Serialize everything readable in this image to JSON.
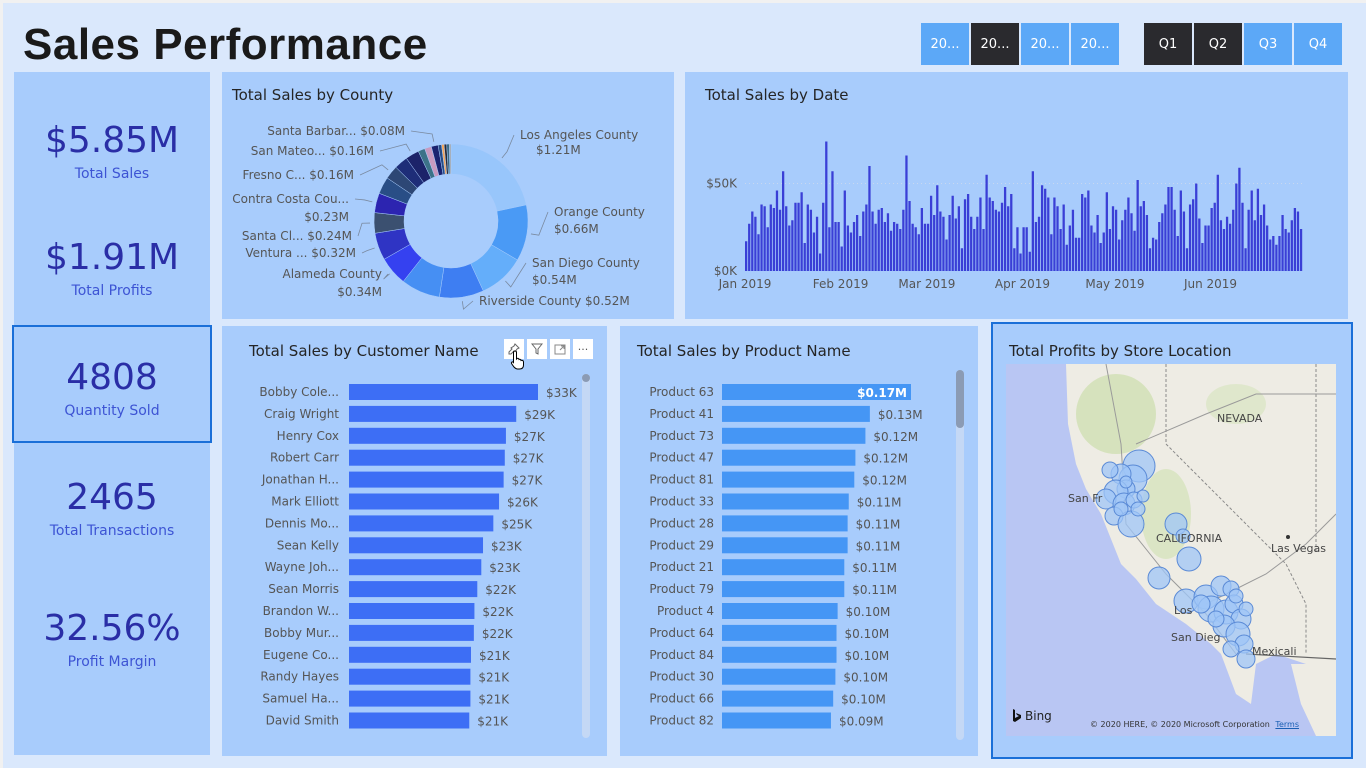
{
  "header": {
    "title": "Sales Performance"
  },
  "year_slicer": {
    "items": [
      {
        "label": "20...",
        "selected": false
      },
      {
        "label": "20...",
        "selected": true
      },
      {
        "label": "20...",
        "selected": false
      },
      {
        "label": "20...",
        "selected": false
      }
    ]
  },
  "quarter_slicer": {
    "items": [
      {
        "label": "Q1",
        "selected": true
      },
      {
        "label": "Q2",
        "selected": true
      },
      {
        "label": "Q3",
        "selected": false
      },
      {
        "label": "Q4",
        "selected": false
      }
    ]
  },
  "kpis": {
    "total_sales": {
      "value": "$5.85M",
      "label": "Total Sales"
    },
    "total_profits": {
      "value": "$1.91M",
      "label": "Total Profits"
    },
    "quantity_sold": {
      "value": "4808",
      "label": "Quantity Sold"
    },
    "total_transactions": {
      "value": "2465",
      "label": "Total Transactions"
    },
    "profit_margin": {
      "value": "32.56%",
      "label": "Profit Margin"
    }
  },
  "colors": {
    "customer_bar": "#3d6ef5",
    "product_bar": "#4596f5",
    "date_bar": "#3a3fd6",
    "kpi_value": "#2a2ea6",
    "selected_border": "#1a6fd8"
  },
  "chart_data": [
    {
      "id": "county",
      "type": "pie",
      "title": "Total Sales by County",
      "donut": true,
      "slices": [
        {
          "label": "Los Angeles County",
          "value": 1.21,
          "display": "$1.21M",
          "color": "#98c6fb"
        },
        {
          "label": "Orange County",
          "value": 0.66,
          "display": "$0.66M",
          "color": "#4a9af5"
        },
        {
          "label": "San Diego County",
          "value": 0.54,
          "display": "$0.54M",
          "color": "#64aefa"
        },
        {
          "label": "Riverside County",
          "value": 0.52,
          "display": "$0.52M",
          "color": "#3e7ef2"
        },
        {
          "label": "",
          "value": 0.46,
          "display": "",
          "color": "#468ff3"
        },
        {
          "label": "Alameda County",
          "value": 0.34,
          "display": "$0.34M",
          "color": "#3541f0"
        },
        {
          "label": "Ventura ...",
          "value": 0.32,
          "display": "$0.32M",
          "color": "#2f34c4"
        },
        {
          "label": "Santa Cl...",
          "value": 0.24,
          "display": "$0.24M",
          "color": "#3b5070"
        },
        {
          "label": "Contra Costa Cou...",
          "value": 0.23,
          "display": "$0.23M",
          "color": "#2c24b0"
        },
        {
          "label": "",
          "value": 0.2,
          "display": "",
          "color": "#294e86"
        },
        {
          "label": "Fresno C...",
          "value": 0.16,
          "display": "$0.16M",
          "color": "#2d4775"
        },
        {
          "label": "",
          "value": 0.16,
          "display": "",
          "color": "#1e2d78"
        },
        {
          "label": "San Mateo...",
          "value": 0.16,
          "display": "$0.16M",
          "color": "#1c2369"
        },
        {
          "label": "",
          "value": 0.08,
          "display": "",
          "color": "#3c7288"
        },
        {
          "label": "",
          "value": 0.08,
          "display": "",
          "color": "#c79ac0"
        },
        {
          "label": "Santa Barbar...",
          "value": 0.08,
          "display": "$0.08M",
          "color": "#1a2370"
        },
        {
          "label": "",
          "value": 0.04,
          "display": "",
          "color": "#274c86"
        },
        {
          "label": "",
          "value": 0.03,
          "display": "",
          "color": "#f5a65b"
        },
        {
          "label": "",
          "value": 0.03,
          "display": "",
          "color": "#2b2b35"
        },
        {
          "label": "",
          "value": 0.03,
          "display": "",
          "color": "#3a6a84"
        },
        {
          "label": "",
          "value": 0.02,
          "display": "",
          "color": "#a6a6a6"
        }
      ]
    },
    {
      "id": "date",
      "type": "bar",
      "title": "Total Sales by Date",
      "xlabel": "",
      "ylabel": "",
      "y_ticks": [
        "$0K",
        "$50K"
      ],
      "ylim": [
        0,
        80000
      ],
      "x_ticks": [
        "Jan 2019",
        "Feb 2019",
        "Mar 2019",
        "Apr 2019",
        "May 2019",
        "Jun 2019"
      ],
      "start_date": "2019-01-01",
      "values": [
        17000,
        27000,
        34000,
        31000,
        21000,
        38000,
        37000,
        25000,
        38000,
        36000,
        46000,
        35000,
        57000,
        37000,
        26000,
        29000,
        39000,
        39000,
        45000,
        16000,
        38000,
        35000,
        22000,
        31000,
        10000,
        39000,
        74000,
        25000,
        57000,
        28000,
        28000,
        14000,
        46000,
        26000,
        22000,
        28000,
        32000,
        20000,
        34000,
        38000,
        60000,
        34000,
        27000,
        35000,
        36000,
        28000,
        33000,
        23000,
        28000,
        27000,
        24000,
        35000,
        66000,
        40000,
        27000,
        25000,
        21000,
        36000,
        27000,
        27000,
        43000,
        32000,
        49000,
        34000,
        31000,
        18000,
        32000,
        43000,
        30000,
        37000,
        13000,
        41000,
        44000,
        31000,
        24000,
        31000,
        42000,
        24000,
        55000,
        42000,
        40000,
        35000,
        34000,
        39000,
        48000,
        37000,
        44000,
        13000,
        25000,
        10000,
        25000,
        25000,
        11000,
        57000,
        28000,
        31000,
        49000,
        47000,
        42000,
        21000,
        42000,
        37000,
        24000,
        38000,
        15000,
        26000,
        35000,
        19000,
        19000,
        44000,
        42000,
        46000,
        26000,
        22000,
        32000,
        16000,
        22000,
        45000,
        24000,
        37000,
        35000,
        18000,
        29000,
        35000,
        42000,
        33000,
        23000,
        52000,
        37000,
        40000,
        32000,
        13000,
        19000,
        18000,
        28000,
        33000,
        38000,
        48000,
        48000,
        35000,
        20000,
        46000,
        34000,
        13000,
        38000,
        41000,
        50000,
        30000,
        16000,
        26000,
        26000,
        36000,
        39000,
        55000,
        29000,
        24000,
        31000,
        27000,
        35000,
        50000,
        59000,
        39000,
        13000,
        35000,
        46000,
        29000,
        47000,
        32000,
        38000,
        26000,
        18000,
        20000,
        15000,
        20000,
        32000,
        24000,
        22000,
        29000,
        36000,
        34000,
        24000
      ]
    },
    {
      "id": "customer",
      "type": "bar",
      "orientation": "horizontal",
      "title": "Total Sales by Customer Name",
      "categories": [
        "Bobby Cole...",
        "Craig Wright",
        "Henry Cox",
        "Robert Carr",
        "Jonathan H...",
        "Mark Elliott",
        "Dennis Mo...",
        "Sean Kelly",
        "Wayne Joh...",
        "Sean Morris",
        "Brandon W...",
        "Bobby Mur...",
        "Eugene Co...",
        "Randy Hayes",
        "Samuel Ha...",
        "David Smith"
      ],
      "values": [
        33000,
        29200,
        27400,
        27200,
        27000,
        26200,
        25200,
        23400,
        23100,
        22400,
        21900,
        21800,
        21300,
        21200,
        21200,
        21000
      ],
      "labels": [
        "$33K",
        "$29K",
        "$27K",
        "$27K",
        "$27K",
        "$26K",
        "$25K",
        "$23K",
        "$23K",
        "$22K",
        "$22K",
        "$22K",
        "$21K",
        "$21K",
        "$21K",
        "$21K"
      ],
      "xlim": [
        0,
        33000
      ]
    },
    {
      "id": "product",
      "type": "bar",
      "orientation": "horizontal",
      "title": "Total Sales by Product Name",
      "categories": [
        "Product 63",
        "Product 41",
        "Product 73",
        "Product 47",
        "Product 81",
        "Product 33",
        "Product 28",
        "Product 29",
        "Product 21",
        "Product 79",
        "Product 4",
        "Product 64",
        "Product 84",
        "Product 30",
        "Product 66",
        "Product 82"
      ],
      "values": [
        0.17,
        0.133,
        0.129,
        0.12,
        0.119,
        0.114,
        0.113,
        0.113,
        0.11,
        0.11,
        0.104,
        0.103,
        0.103,
        0.102,
        0.1,
        0.098
      ],
      "labels": [
        "$0.17M",
        "$0.13M",
        "$0.12M",
        "$0.12M",
        "$0.12M",
        "$0.11M",
        "$0.11M",
        "$0.11M",
        "$0.11M",
        "$0.11M",
        "$0.10M",
        "$0.10M",
        "$0.10M",
        "$0.10M",
        "$0.10M",
        "$0.09M"
      ],
      "xlim": [
        0,
        0.17
      ]
    }
  ],
  "map": {
    "title": "Total Profits by Store Location",
    "labels": {
      "nevada": "NEVADA",
      "california": "CALIFORNIA",
      "las_vegas": "Las Vegas",
      "san_francisco": "San Fr",
      "los_angeles": "Los",
      "san_diego": "San Dieg",
      "mexicali": "Mexicali"
    },
    "brand": "Bing",
    "copyright": "© 2020 HERE, © 2020 Microsoft Corporation",
    "terms": "Terms"
  },
  "visual_header": {
    "pin": "pin-icon",
    "filter": "filter-icon",
    "focus": "focus-mode-icon",
    "more": "more-options-icon"
  }
}
